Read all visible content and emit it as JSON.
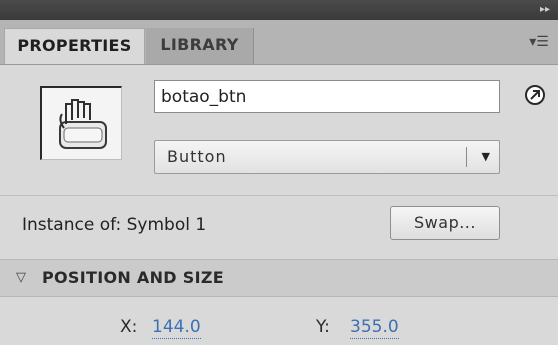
{
  "tabs": [
    {
      "label": "PROPERTIES",
      "active": true
    },
    {
      "label": "LIBRARY",
      "active": false
    }
  ],
  "icons": {
    "collapse": "double-right-arrow-icon",
    "panel_menu": "panel-menu-icon",
    "symbol": "button-symbol-hand-icon",
    "help": "arrow-circle-icon",
    "dropdown": "chevron-down-icon",
    "section_toggle": "triangle-down-icon"
  },
  "instance": {
    "name_value": "botao_btn",
    "type_selected": "Button",
    "instance_of_label": "Instance of: Symbol 1",
    "swap_label": "Swap..."
  },
  "position_and_size": {
    "title": "POSITION AND SIZE",
    "x_label": "X:",
    "x_value": "144.0",
    "y_label": "Y:",
    "y_value": "355.0"
  },
  "colors": {
    "panel_bg": "#d9d9d9",
    "tabstrip_bg": "#b4b4b4",
    "value_link": "#3d6fb5"
  }
}
